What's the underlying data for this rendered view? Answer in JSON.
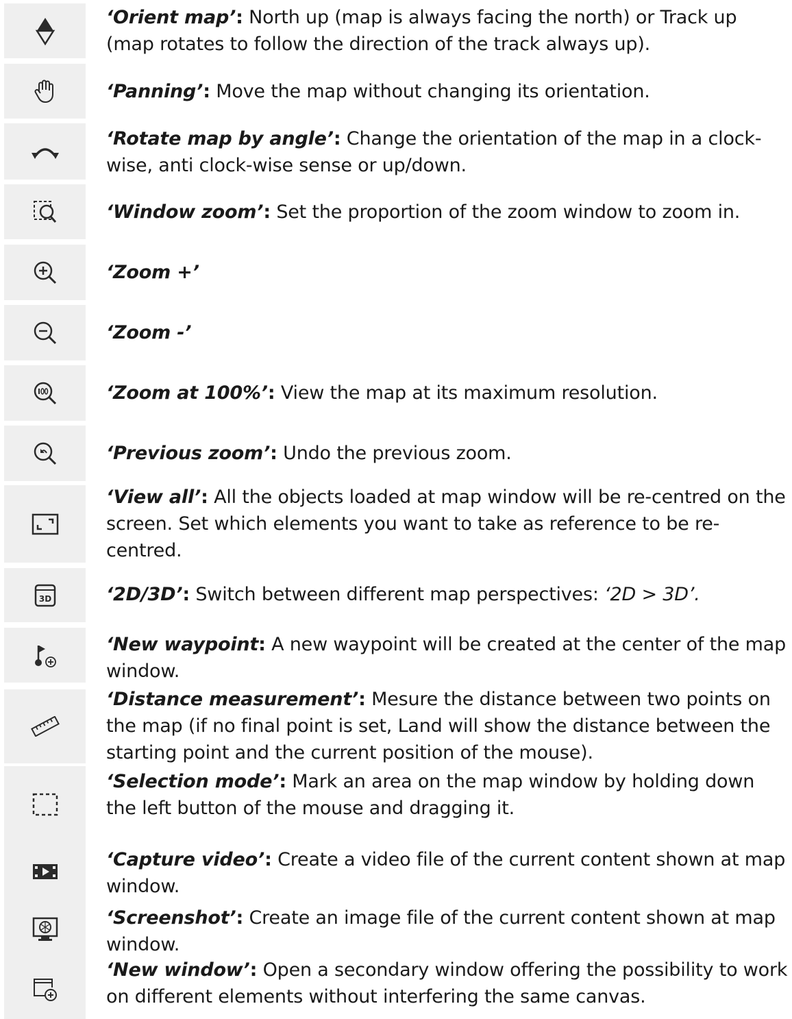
{
  "items": [
    {
      "icon": "orient-map-icon",
      "term": "‘Orient map’",
      "colon": ":",
      "desc": " North up (map is always facing the north) or Track up (map rotates to follow the direction of the track always up).",
      "extra": ""
    },
    {
      "icon": "hand-icon",
      "term": "‘Panning’",
      "colon": ":",
      "desc": " Move the map without changing its orientation.",
      "extra": ""
    },
    {
      "icon": "rotate-icon",
      "term": "‘Rotate map by angle’",
      "colon": ":",
      "desc": " Change the orientation of the map in a clock-wise, anti clock-wise sense or up/down.",
      "extra": ""
    },
    {
      "icon": "window-zoom-icon",
      "term": "‘Window zoom’",
      "colon": ":",
      "desc": " Set the proportion of the zoom window to zoom in.",
      "extra": ""
    },
    {
      "icon": "zoom-in-icon",
      "term": "‘Zoom +’",
      "colon": "",
      "desc": "",
      "extra": ""
    },
    {
      "icon": "zoom-out-icon",
      "term": "‘Zoom -’",
      "colon": "",
      "desc": "",
      "extra": ""
    },
    {
      "icon": "zoom-100-icon",
      "term": "‘Zoom at 100%’",
      "colon": ":",
      "desc": " View the map at its maximum resolution.",
      "extra": ""
    },
    {
      "icon": "previous-zoom-icon",
      "term": "‘Previous zoom’",
      "colon": ":",
      "desc": " Undo the previous zoom.",
      "extra": ""
    },
    {
      "icon": "view-all-icon",
      "term": "‘View all’",
      "colon": ":",
      "desc": " All the objects loaded at map window will be re-centred on the screen. Set which elements you want to take as reference to be re-centred.",
      "extra": ""
    },
    {
      "icon": "3d-icon",
      "term": "‘2D/3D’",
      "colon": ":",
      "desc": " Switch between different map perspectives: ",
      "extra": "‘2D > 3D’."
    },
    {
      "icon": "new-waypoint-icon",
      "term": "‘New waypoint",
      "colon": ":",
      "desc": " A new waypoint will be created at the center of the map window.",
      "extra": ""
    },
    {
      "icon": "ruler-icon",
      "term": "‘Distance measurement’",
      "colon": ":",
      "desc": " Mesure the distance between two points on the map (if no final point is set, Land will show the distance between the starting point and the current position of the mouse).",
      "extra": ""
    },
    {
      "icon": "selection-icon",
      "term": "‘Selection mode’",
      "colon": ":",
      "desc": " Mark an area on the map window by holding down the left button of the mouse and dragging it.",
      "extra": ""
    },
    {
      "icon": "video-icon",
      "term": "‘Capture video’",
      "colon": ":",
      "desc": " Create a video file of the current content shown at map window.",
      "extra": ""
    },
    {
      "icon": "screenshot-icon",
      "term": "‘Screenshot’",
      "colon": ":",
      "desc": " Create an image file of the current content shown at map window.",
      "extra": ""
    },
    {
      "icon": "new-window-icon",
      "term": "‘New window’",
      "colon": ":",
      "desc": " Open a secondary window offering the possibility to work on different elements without interfering the same canvas.",
      "extra": ""
    }
  ]
}
